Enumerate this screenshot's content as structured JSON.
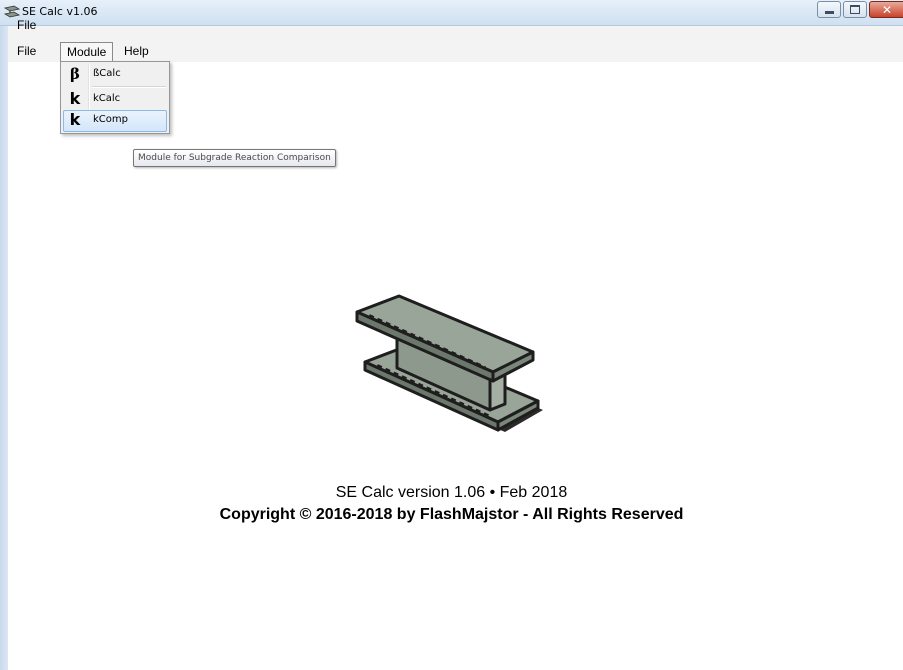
{
  "window": {
    "title": "SE Calc v1.06",
    "icon": "beam-app-icon",
    "controls": {
      "minimize": "minimize-icon",
      "maximize": "maximize-icon",
      "close": "close-icon"
    }
  },
  "menubar": {
    "file_label": "File",
    "module_label": "Module",
    "help_label": "Help"
  },
  "module_menu": {
    "items": [
      {
        "glyph": "β",
        "label": "ßCalc",
        "highlighted": false
      },
      {
        "glyph": "k",
        "label": "kCalc",
        "highlighted": false
      },
      {
        "glyph": "k",
        "label": "kComp",
        "highlighted": true
      }
    ]
  },
  "tooltip": {
    "text": "Module for Subgrade Reaction Comparison"
  },
  "splash": {
    "image": "steel-i-beam-icon",
    "version_text": "SE Calc version 1.06 • Feb 2018",
    "copyright_text": "Copyright © 2016-2018 by FlashMajstor - All Rights Reserved"
  },
  "colors": {
    "menu_highlight": "#d3e6fa",
    "beam_fill": "#9aa59a",
    "close_button": "#c7432b"
  }
}
